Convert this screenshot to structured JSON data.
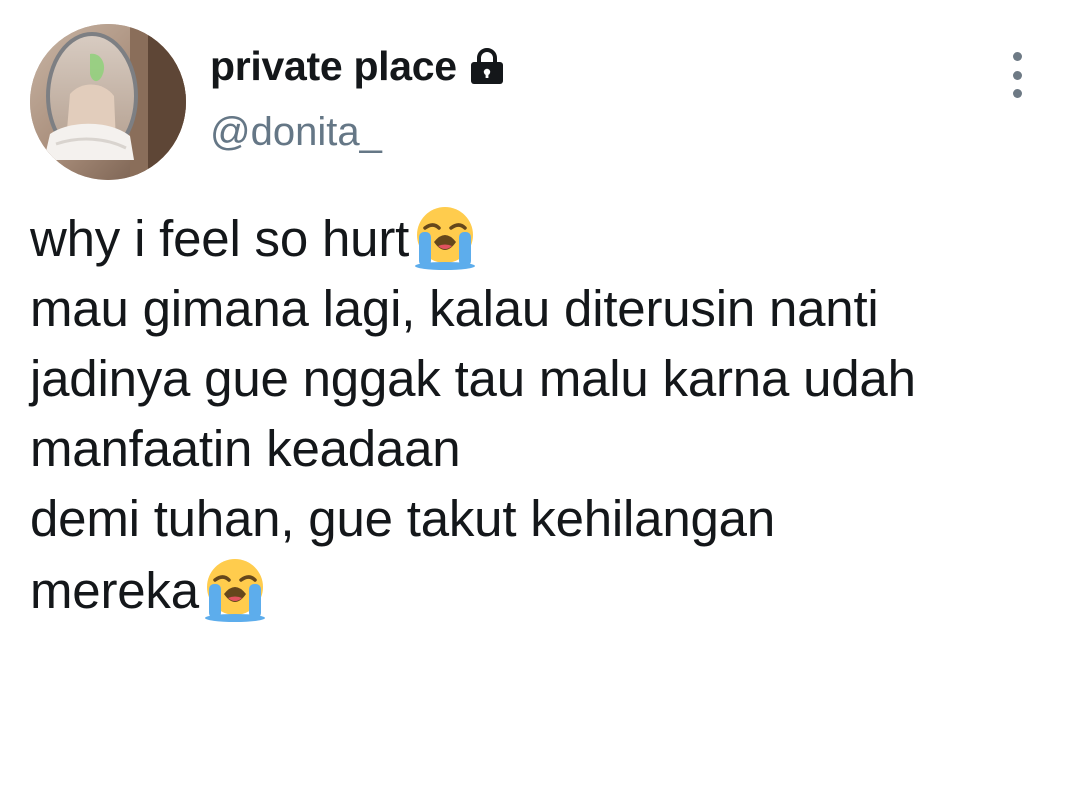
{
  "user": {
    "display_name": "private place",
    "handle": "@donita_",
    "protected_icon": "lock-icon",
    "avatar": "profile-photo"
  },
  "menu": {
    "icon": "more-vertical-icon"
  },
  "tweet": {
    "lines": [
      {
        "text": "why i feel so hurt",
        "emoji": "loudly-crying-face"
      },
      {
        "text": "mau gimana lagi, kalau diterusin nanti"
      },
      {
        "text": "jadinya gue nggak tau malu karna udah"
      },
      {
        "text": "manfaatin keadaan"
      },
      {
        "text": "demi tuhan, gue takut kehilangan"
      },
      {
        "text": "mereka",
        "emoji": "loudly-crying-face"
      }
    ]
  },
  "colors": {
    "text": "#14171a",
    "handle": "#657786",
    "icon": "#6e7a85",
    "background": "#ffffff"
  }
}
